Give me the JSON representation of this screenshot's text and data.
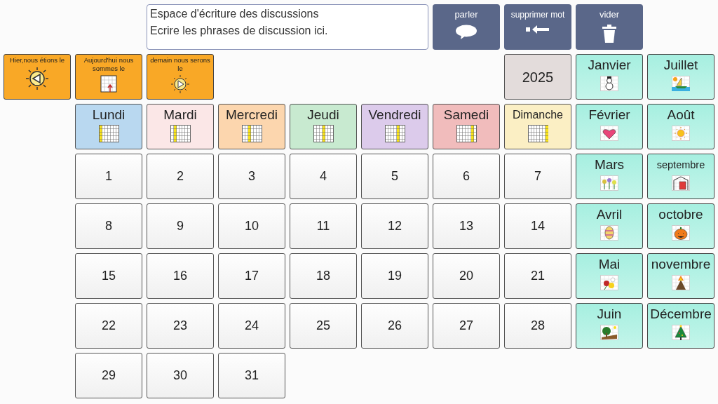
{
  "text_area": {
    "lines": [
      "Espace d'écriture des discussions",
      "Ecrire les phrases de discussion ici."
    ]
  },
  "action_buttons": [
    {
      "label": "parler",
      "kind": "speak"
    },
    {
      "label": "supprimer mot",
      "kind": "delete"
    },
    {
      "label": "vider",
      "kind": "clear"
    }
  ],
  "relative_days": [
    {
      "label": "Hier,nous  étions le",
      "kind": "yesterday"
    },
    {
      "label": "Aujourd'hui nous sommes le",
      "kind": "today"
    },
    {
      "label": "demain nous serons le",
      "kind": "tomorrow"
    }
  ],
  "year": "2025",
  "weekdays": [
    {
      "label": "Lundi",
      "color": "#b9d8f0"
    },
    {
      "label": "Mardi",
      "color": "#fbe7e7"
    },
    {
      "label": "Mercredi",
      "color": "#fcd6ae"
    },
    {
      "label": "Jeudi",
      "color": "#c8ead0"
    },
    {
      "label": "Vendredi",
      "color": "#dccbeb"
    },
    {
      "label": "Samedi",
      "color": "#f1bcbc"
    },
    {
      "label": "Dimanche",
      "color": "#fbefc4"
    }
  ],
  "days": [
    "1",
    "2",
    "3",
    "4",
    "5",
    "6",
    "7",
    "8",
    "9",
    "10",
    "11",
    "12",
    "13",
    "14",
    "15",
    "16",
    "17",
    "18",
    "19",
    "20",
    "21",
    "22",
    "23",
    "24",
    "25",
    "26",
    "27",
    "28",
    "29",
    "30",
    "31"
  ],
  "months": [
    {
      "label": "Janvier"
    },
    {
      "label": "Juillet"
    },
    {
      "label": "Février"
    },
    {
      "label": "Août"
    },
    {
      "label": "Mars"
    },
    {
      "label": "septembre"
    },
    {
      "label": "Avril"
    },
    {
      "label": "octobre"
    },
    {
      "label": "Mai"
    },
    {
      "label": "novembre"
    },
    {
      "label": "Juin"
    },
    {
      "label": "Décembre"
    }
  ]
}
